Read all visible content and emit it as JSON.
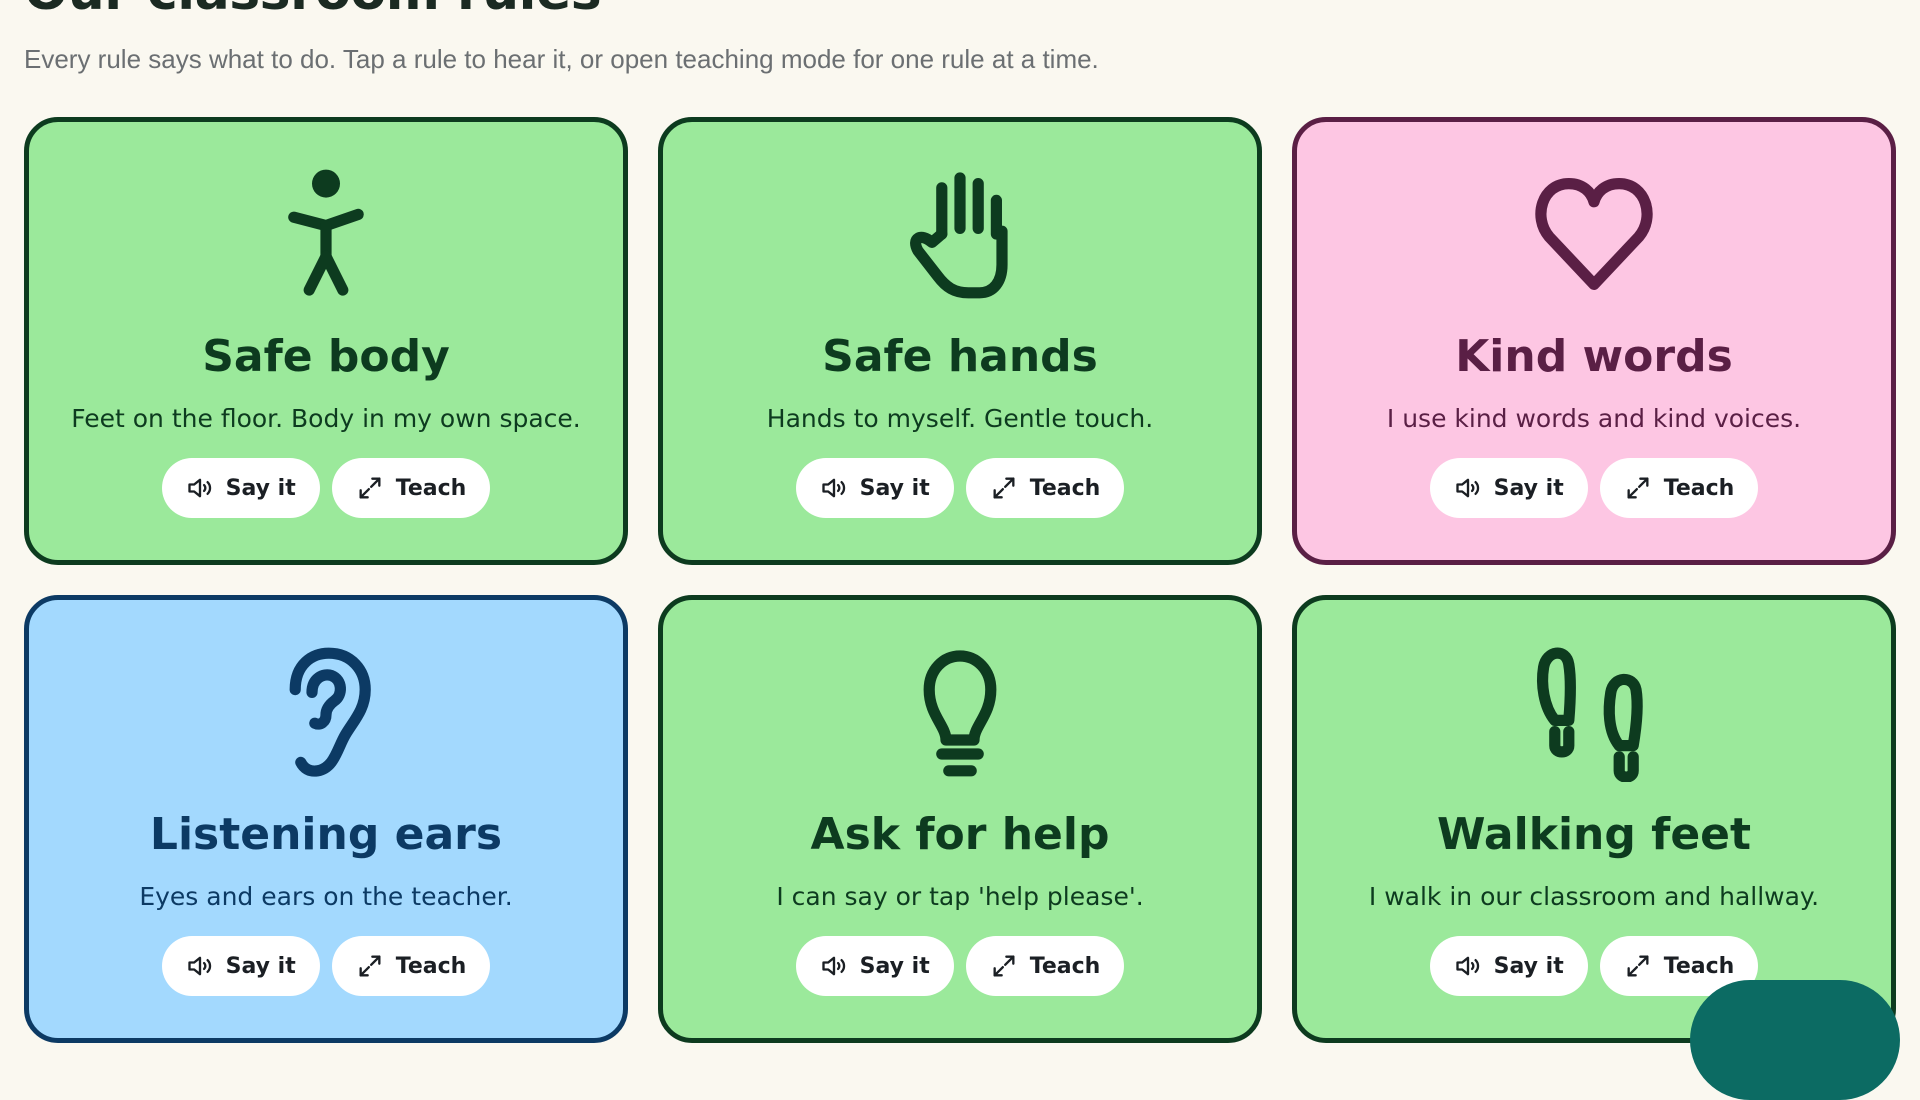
{
  "page": {
    "title": "Our classroom rules",
    "subtitle": "Every rule says what to do. Tap a rule to hear it, or open teaching mode for one rule at a time."
  },
  "colors": {
    "background": "#faf8f0",
    "green_fill": "#9be99b",
    "green_ink": "#0d3b1f",
    "pink_fill": "#fdc6e3",
    "pink_ink": "#5a1f45",
    "blue_fill": "#a3d9fe",
    "blue_ink": "#0c3a64",
    "fab": "#0c6b63"
  },
  "actions": {
    "say_label": "Say it",
    "teach_label": "Teach",
    "say_icon": "speaker-icon",
    "teach_icon": "expand-icon"
  },
  "rules": [
    {
      "title": "Safe body",
      "text": "Feet on the floor. Body in my own space.",
      "icon": "person-icon",
      "theme": "green"
    },
    {
      "title": "Safe hands",
      "text": "Hands to myself. Gentle touch.",
      "icon": "hand-icon",
      "theme": "green"
    },
    {
      "title": "Kind words",
      "text": "I use kind words and kind voices.",
      "icon": "heart-icon",
      "theme": "pink"
    },
    {
      "title": "Listening ears",
      "text": "Eyes and ears on the teacher.",
      "icon": "ear-icon",
      "theme": "blue"
    },
    {
      "title": "Ask for help",
      "text": "I can say or tap 'help please'.",
      "icon": "lightbulb-icon",
      "theme": "green"
    },
    {
      "title": "Walking feet",
      "text": "I walk in our classroom and hallway.",
      "icon": "footprints-icon",
      "theme": "green"
    }
  ]
}
